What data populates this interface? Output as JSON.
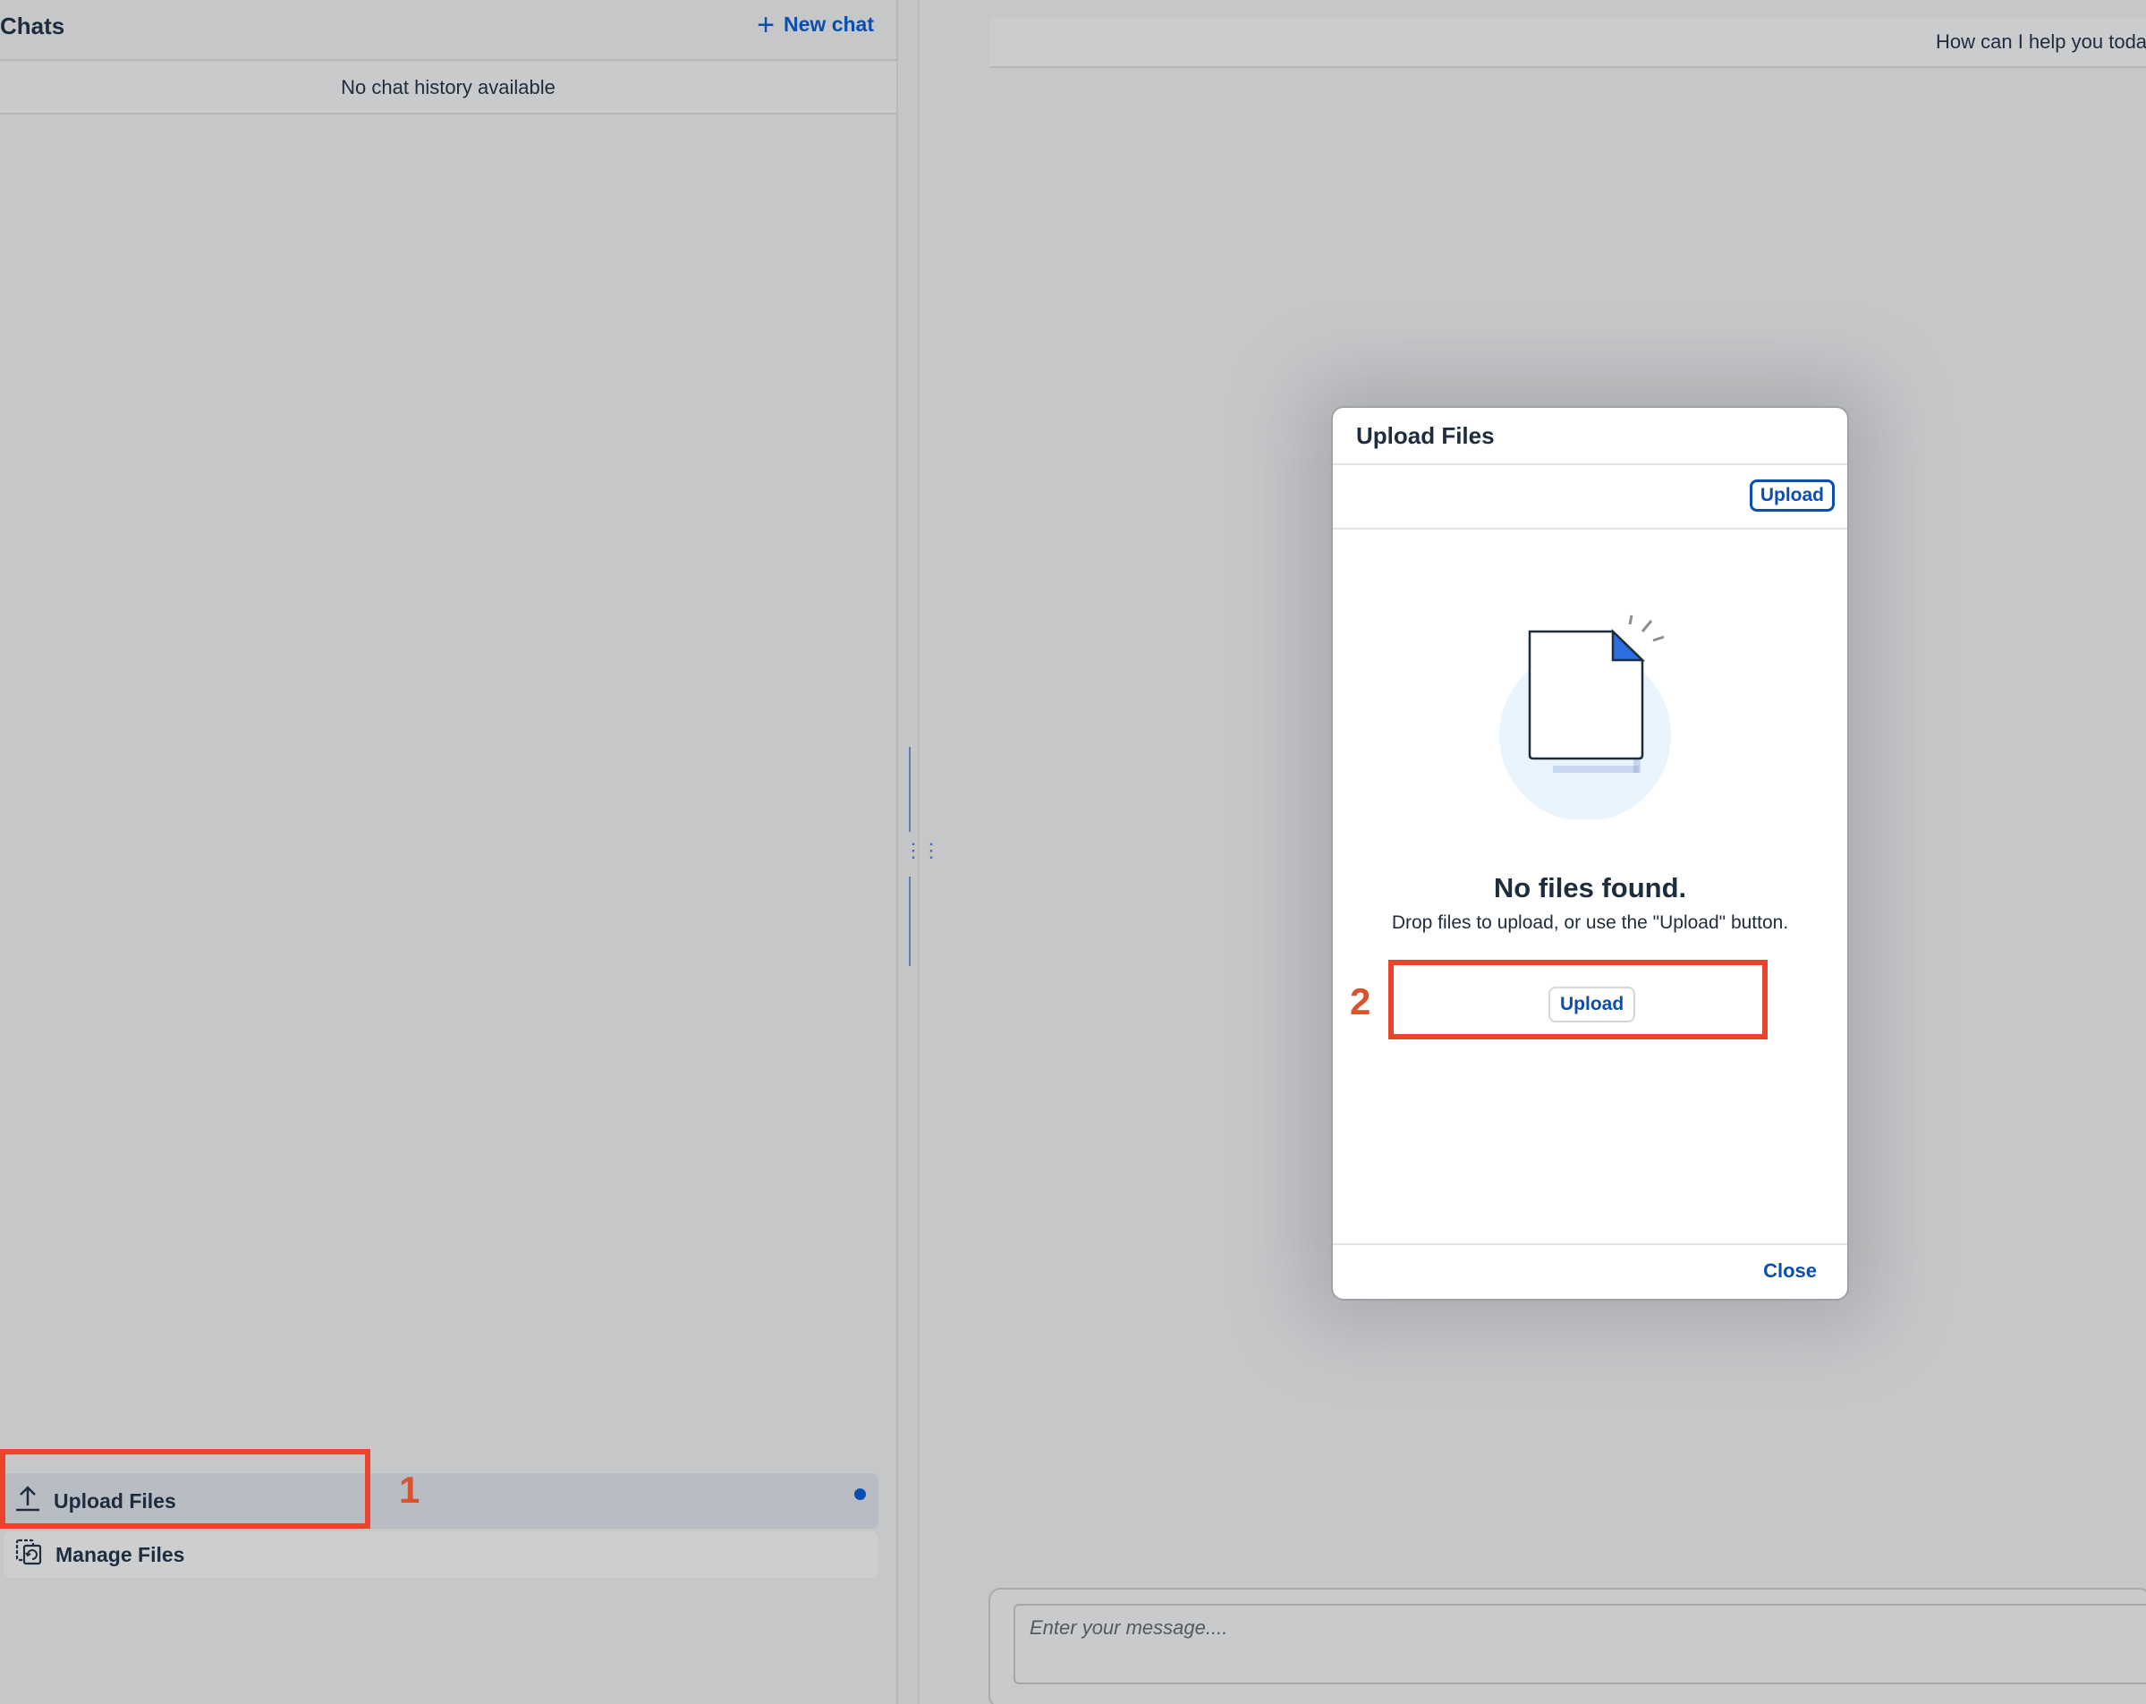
{
  "left_panel": {
    "title": "Chats",
    "new_chat_label": "New chat",
    "no_history": "No chat history available",
    "upload_files_label": "Upload Files",
    "manage_files_label": "Manage Files"
  },
  "chat": {
    "greeting": "How can I help you toda",
    "message_placeholder": "Enter your message...."
  },
  "dialog": {
    "title": "Upload Files",
    "toolbar_upload": "Upload",
    "empty_title": "No files found.",
    "empty_subtitle": "Drop files to upload, or use the \"Upload\" button.",
    "body_upload": "Upload",
    "close_label": "Close"
  },
  "annotations": {
    "step1": "1",
    "step2": "2"
  },
  "colors": {
    "accent": "#0a4fb0",
    "annotation": "#e8452c",
    "backdrop": "#c6c7c9"
  },
  "icons": {
    "new_chat": "plus-icon",
    "upload_files": "upload-icon",
    "manage_files": "manage-files-icon",
    "splitter": "grip-icon",
    "empty_state": "document-icon"
  }
}
